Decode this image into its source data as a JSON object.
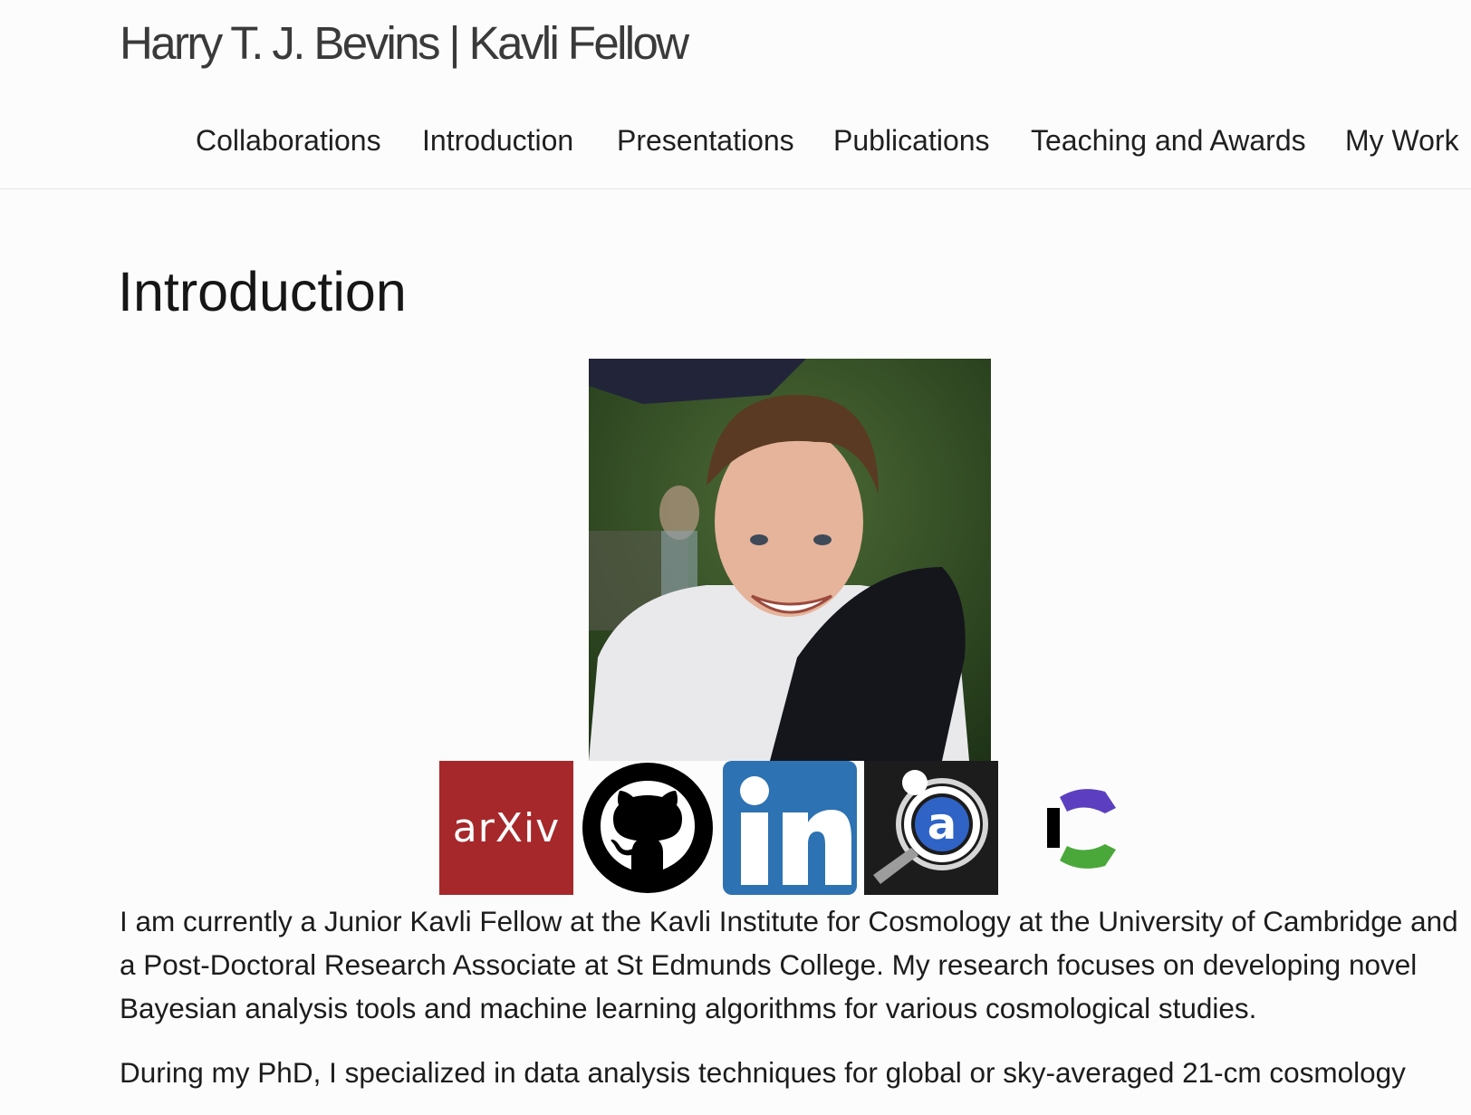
{
  "site": {
    "title": "Harry T. J. Bevins | Kavli Fellow"
  },
  "nav": {
    "items": [
      {
        "label": "Collaborations"
      },
      {
        "label": "Introduction"
      },
      {
        "label": "Presentations"
      },
      {
        "label": "Publications"
      },
      {
        "label": "Teaching and Awards"
      },
      {
        "label": "My Work"
      }
    ]
  },
  "page": {
    "heading": "Introduction",
    "portrait_icon": "profile-photo",
    "social_links": [
      {
        "name": "arXiv",
        "icon": "arxiv-icon",
        "label": "arXiv",
        "color": "#a6282b"
      },
      {
        "name": "GitHub",
        "icon": "github-icon",
        "color": "#000000"
      },
      {
        "name": "LinkedIn",
        "icon": "linkedin-icon",
        "label": "in",
        "color": "#2d72b2"
      },
      {
        "name": "ADS",
        "icon": "ads-icon",
        "label": "a",
        "color": "#1c1c1c"
      },
      {
        "name": "Semantic Scholar",
        "icon": "scholar-icon",
        "color": "#5b3fc0"
      }
    ],
    "paragraphs": [
      "I am currently a Junior Kavli Fellow at the Kavli Institute for Cosmology at the University of Cambridge and a Post-Doctoral Research Associate at St Edmunds College. My research focuses on developing novel Bayesian analysis tools and machine learning algorithms for various cosmological studies.",
      "During my PhD, I specialized in data analysis techniques for global or sky-averaged 21-cm cosmology"
    ]
  }
}
